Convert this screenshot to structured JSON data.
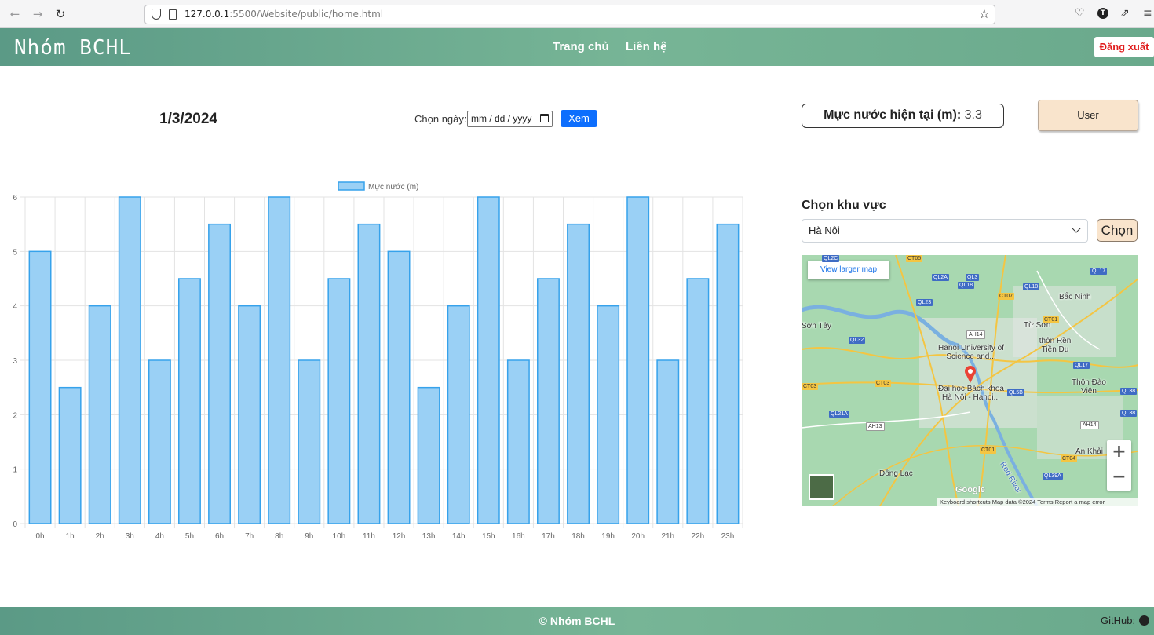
{
  "browser": {
    "url_host": "127.0.0.1",
    "url_path": ":5500/Website/public/home.html",
    "back_icon": "arrow-left-icon",
    "forward_icon": "arrow-right-icon",
    "reload_icon": "reload-icon",
    "bookmark_icon": "star-icon"
  },
  "navbar": {
    "brand": "Nhóm BCHL",
    "links": [
      "Trang chủ",
      "Liên hệ"
    ],
    "logout": "Đăng xuất"
  },
  "controls": {
    "date": "1/3/2024",
    "choose_date_label": "Chọn ngày:",
    "date_placeholder": "mm / dd / yyyy",
    "view_button": "Xem",
    "level_label": "Mực nước hiện tại (m):",
    "level_value": "3.3",
    "user_button": "User"
  },
  "area": {
    "title": "Chọn khu vực",
    "selected": "Hà Nội",
    "choose_button": "Chọn"
  },
  "map": {
    "view_larger": "View larger map",
    "places": [
      "Bắc Ninh",
      "Từ Sơn",
      "thôn Rền Tiền Du",
      "Hanoi University of Science and...",
      "Đại học Bách khoa Hà Nội - Hanoi...",
      "Thôn Đào Viên",
      "An Khải",
      "Đồng Lạc",
      "Sơn Tây",
      "Red River"
    ],
    "roads": [
      "CT05",
      "QL2A",
      "QL3",
      "QL18",
      "QL17",
      "QL23",
      "CT07",
      "QL18",
      "CT01",
      "AH14",
      "QL32",
      "QL17",
      "CT03",
      "CT03",
      "QL5B",
      "QL38",
      "QL21A",
      "AH13",
      "QL38",
      "AH14",
      "CT01",
      "CT04",
      "QL39A",
      "QL2C"
    ],
    "zoom_in": "+",
    "zoom_out": "−",
    "google": "Google",
    "attribution": "Keyboard shortcuts   Map data ©2024   Terms   Report a map error"
  },
  "footer": {
    "text": "© Nhóm BCHL",
    "github": "GitHub:"
  },
  "colors": {
    "bar_fill": "#9ad0f5",
    "bar_stroke": "#36a2eb",
    "header_green": "#6aa98c",
    "view_button_blue": "#0d6efd",
    "logout_red": "#e01b1b"
  },
  "chart_data": {
    "type": "bar",
    "legend": "Mực nước (m)",
    "categories": [
      "0h",
      "1h",
      "2h",
      "3h",
      "4h",
      "5h",
      "6h",
      "7h",
      "8h",
      "9h",
      "10h",
      "11h",
      "12h",
      "13h",
      "14h",
      "15h",
      "16h",
      "17h",
      "18h",
      "19h",
      "20h",
      "21h",
      "22h",
      "23h"
    ],
    "series": [
      {
        "name": "Mực nước (m)",
        "values": [
          5,
          2.5,
          4,
          6,
          3,
          4.5,
          5.5,
          4,
          6,
          3,
          4.5,
          5.5,
          5,
          2.5,
          4,
          6,
          3,
          4.5,
          5.5,
          4,
          6,
          3,
          4.5,
          5.5
        ]
      }
    ],
    "ylim": [
      0,
      6
    ],
    "yticks": [
      0,
      1,
      2,
      3,
      4,
      5,
      6
    ],
    "grid": true,
    "legend_position": "top"
  }
}
